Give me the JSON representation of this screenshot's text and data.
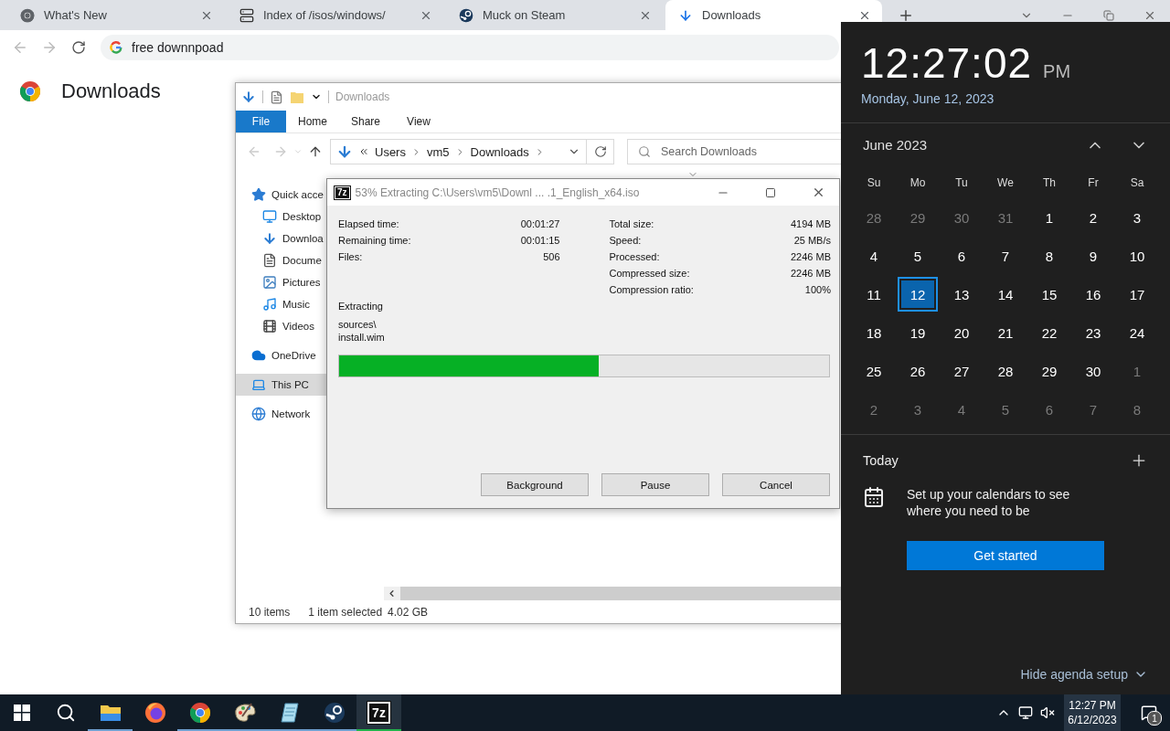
{
  "browser": {
    "tabs": [
      {
        "title": "What's New",
        "selected": false
      },
      {
        "title": "Index of /isos/windows/",
        "selected": false
      },
      {
        "title": "Muck on Steam",
        "selected": false
      },
      {
        "title": "Downloads",
        "selected": true
      }
    ],
    "omnibox": {
      "value": "free downnpoad"
    },
    "page_title": "Downloads"
  },
  "explorer": {
    "title": "Downloads",
    "ribbon_tabs": [
      {
        "label": "File",
        "kind": "backstage"
      },
      {
        "label": "Home",
        "kind": "tab"
      },
      {
        "label": "Share",
        "kind": "tab"
      },
      {
        "label": "View",
        "kind": "tab"
      }
    ],
    "breadcrumb": [
      "Users",
      "vm5",
      "Downloads"
    ],
    "search": {
      "placeholder": "Search Downloads"
    },
    "nav": [
      {
        "label": "Quick acce",
        "selected": false,
        "children": [
          {
            "label": "Desktop",
            "selected": false
          },
          {
            "label": "Downloa",
            "selected": false
          },
          {
            "label": "Docume",
            "selected": false
          },
          {
            "label": "Pictures",
            "selected": false
          },
          {
            "label": "Music",
            "selected": false
          },
          {
            "label": "Videos",
            "selected": false
          }
        ]
      },
      {
        "label": "OneDrive",
        "selected": false
      },
      {
        "label": "This PC",
        "selected": true
      },
      {
        "label": "Network",
        "selected": false
      }
    ],
    "status": [
      "10 items",
      "1 item selected",
      "4.02 GB"
    ]
  },
  "extract_dialog": {
    "icon_label": "7z",
    "title": "53% Extracting C:\\Users\\vm5\\Downl ... .1_English_x64.iso",
    "left_stats": [
      {
        "label": "Elapsed time:",
        "value": "00:01:27"
      },
      {
        "label": "Remaining time:",
        "value": "00:01:15"
      },
      {
        "label": "Files:",
        "value": "506"
      }
    ],
    "right_stats": [
      {
        "label": "Total size:",
        "value": "4194 MB"
      },
      {
        "label": "Speed:",
        "value": "25 MB/s"
      },
      {
        "label": "Processed:",
        "value": "2246 MB"
      },
      {
        "label": "Compressed size:",
        "value": "2246 MB"
      },
      {
        "label": "Compression ratio:",
        "value": "100%"
      }
    ],
    "action": "Extracting",
    "current_path": [
      "sources\\",
      "install.wim"
    ],
    "progress": {
      "level": 0.53
    },
    "buttons": [
      "Background",
      "Pause",
      "Cancel"
    ]
  },
  "calendar_flyout": {
    "time": "12:27:02",
    "ampm": "PM",
    "date": "Monday, June 12, 2023",
    "month": "June 2023",
    "weekdays": [
      "Su",
      "Mo",
      "Tu",
      "We",
      "Th",
      "Fr",
      "Sa"
    ],
    "weeks": [
      [
        {
          "day": "28",
          "in_month": false,
          "selected": false
        },
        {
          "day": "29",
          "in_month": false,
          "selected": false
        },
        {
          "day": "30",
          "in_month": false,
          "selected": false
        },
        {
          "day": "31",
          "in_month": false,
          "selected": false
        },
        {
          "day": "1",
          "in_month": true,
          "selected": false
        },
        {
          "day": "2",
          "in_month": true,
          "selected": false
        },
        {
          "day": "3",
          "in_month": true,
          "selected": false
        }
      ],
      [
        {
          "day": "4",
          "in_month": true,
          "selected": false
        },
        {
          "day": "5",
          "in_month": true,
          "selected": false
        },
        {
          "day": "6",
          "in_month": true,
          "selected": false
        },
        {
          "day": "7",
          "in_month": true,
          "selected": false
        },
        {
          "day": "8",
          "in_month": true,
          "selected": false
        },
        {
          "day": "9",
          "in_month": true,
          "selected": false
        },
        {
          "day": "10",
          "in_month": true,
          "selected": false
        }
      ],
      [
        {
          "day": "11",
          "in_month": true,
          "selected": false
        },
        {
          "day": "12",
          "in_month": true,
          "selected": true
        },
        {
          "day": "13",
          "in_month": true,
          "selected": false
        },
        {
          "day": "14",
          "in_month": true,
          "selected": false
        },
        {
          "day": "15",
          "in_month": true,
          "selected": false
        },
        {
          "day": "16",
          "in_month": true,
          "selected": false
        },
        {
          "day": "17",
          "in_month": true,
          "selected": false
        }
      ],
      [
        {
          "day": "18",
          "in_month": true,
          "selected": false
        },
        {
          "day": "19",
          "in_month": true,
          "selected": false
        },
        {
          "day": "20",
          "in_month": true,
          "selected": false
        },
        {
          "day": "21",
          "in_month": true,
          "selected": false
        },
        {
          "day": "22",
          "in_month": true,
          "selected": false
        },
        {
          "day": "23",
          "in_month": true,
          "selected": false
        },
        {
          "day": "24",
          "in_month": true,
          "selected": false
        }
      ],
      [
        {
          "day": "25",
          "in_month": true,
          "selected": false
        },
        {
          "day": "26",
          "in_month": true,
          "selected": false
        },
        {
          "day": "27",
          "in_month": true,
          "selected": false
        },
        {
          "day": "28",
          "in_month": true,
          "selected": false
        },
        {
          "day": "29",
          "in_month": true,
          "selected": false
        },
        {
          "day": "30",
          "in_month": true,
          "selected": false
        },
        {
          "day": "1",
          "in_month": false,
          "selected": false
        }
      ],
      [
        {
          "day": "2",
          "in_month": false,
          "selected": false
        },
        {
          "day": "3",
          "in_month": false,
          "selected": false
        },
        {
          "day": "4",
          "in_month": false,
          "selected": false
        },
        {
          "day": "5",
          "in_month": false,
          "selected": false
        },
        {
          "day": "6",
          "in_month": false,
          "selected": false
        },
        {
          "day": "7",
          "in_month": false,
          "selected": false
        },
        {
          "day": "8",
          "in_month": false,
          "selected": false
        }
      ]
    ],
    "agenda": {
      "heading": "Today",
      "message": "Set up your calendars to see where you need to be",
      "button": "Get started"
    },
    "footer": "Hide agenda setup"
  },
  "taskbar": {
    "apps": [
      {
        "kind": "explorer",
        "running": true,
        "active": false
      },
      {
        "kind": "firefox",
        "running": false,
        "active": false
      },
      {
        "kind": "chrome",
        "running": true,
        "active": false
      },
      {
        "kind": "paint",
        "running": true,
        "active": false
      },
      {
        "kind": "notepad",
        "running": true,
        "active": false
      },
      {
        "kind": "steam",
        "running": true,
        "active": false
      },
      {
        "kind": "sevenzip",
        "label": "7z",
        "running": true,
        "active": true
      }
    ],
    "clock": {
      "time": "12:27 PM",
      "date": "6/12/2023"
    },
    "notifications": {
      "count": "1"
    }
  }
}
